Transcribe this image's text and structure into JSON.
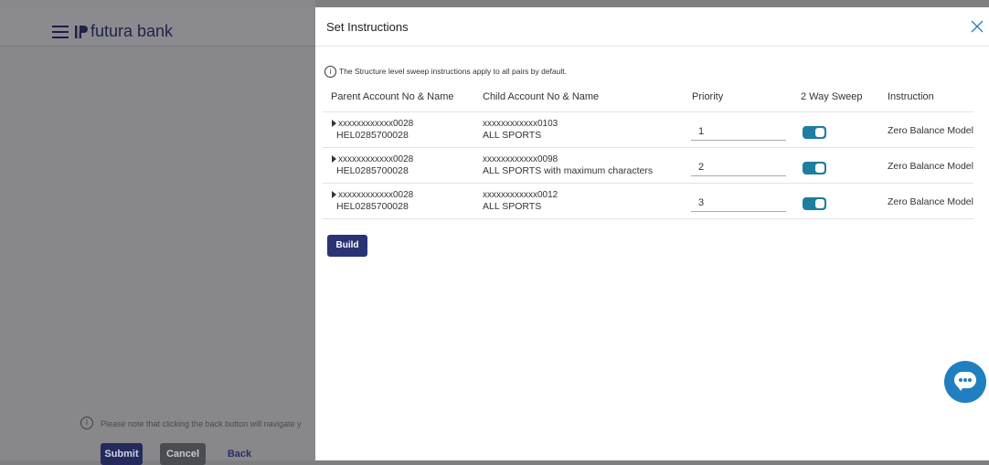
{
  "background": {
    "brand": "futura bank",
    "note": "Please note that clicking the back button will navigate y",
    "buttons": {
      "submit": "Submit",
      "cancel": "Cancel",
      "back": "Back"
    }
  },
  "panel": {
    "title": "Set Instructions",
    "info": "The Structure level sweep instructions apply to all pairs by default.",
    "columns": {
      "parent": "Parent Account No & Name",
      "child": "Child Account No & Name",
      "priority": "Priority",
      "sweep": "2 Way Sweep",
      "instruction": "Instruction"
    },
    "rows": [
      {
        "parent_acct": "xxxxxxxxxxxx0028",
        "parent_name": "HEL0285700028",
        "child_acct": "xxxxxxxxxxxx0103",
        "child_name": "ALL SPORTS",
        "priority": "1",
        "sweep_on": true,
        "instruction": "Zero Balance Model"
      },
      {
        "parent_acct": "xxxxxxxxxxxx0028",
        "parent_name": "HEL0285700028",
        "child_acct": "xxxxxxxxxxxx0098",
        "child_name": "ALL SPORTS with maximum characters",
        "priority": "2",
        "sweep_on": true,
        "instruction": "Zero Balance Model"
      },
      {
        "parent_acct": "xxxxxxxxxxxx0028",
        "parent_name": "HEL0285700028",
        "child_acct": "xxxxxxxxxxxx0012",
        "child_name": "ALL SPORTS",
        "priority": "3",
        "sweep_on": true,
        "instruction": "Zero Balance Model"
      }
    ],
    "build_label": "Build"
  },
  "colors": {
    "primary": "#2a3373",
    "toggle": "#1e7ea0",
    "chat": "#1f7fc0"
  }
}
